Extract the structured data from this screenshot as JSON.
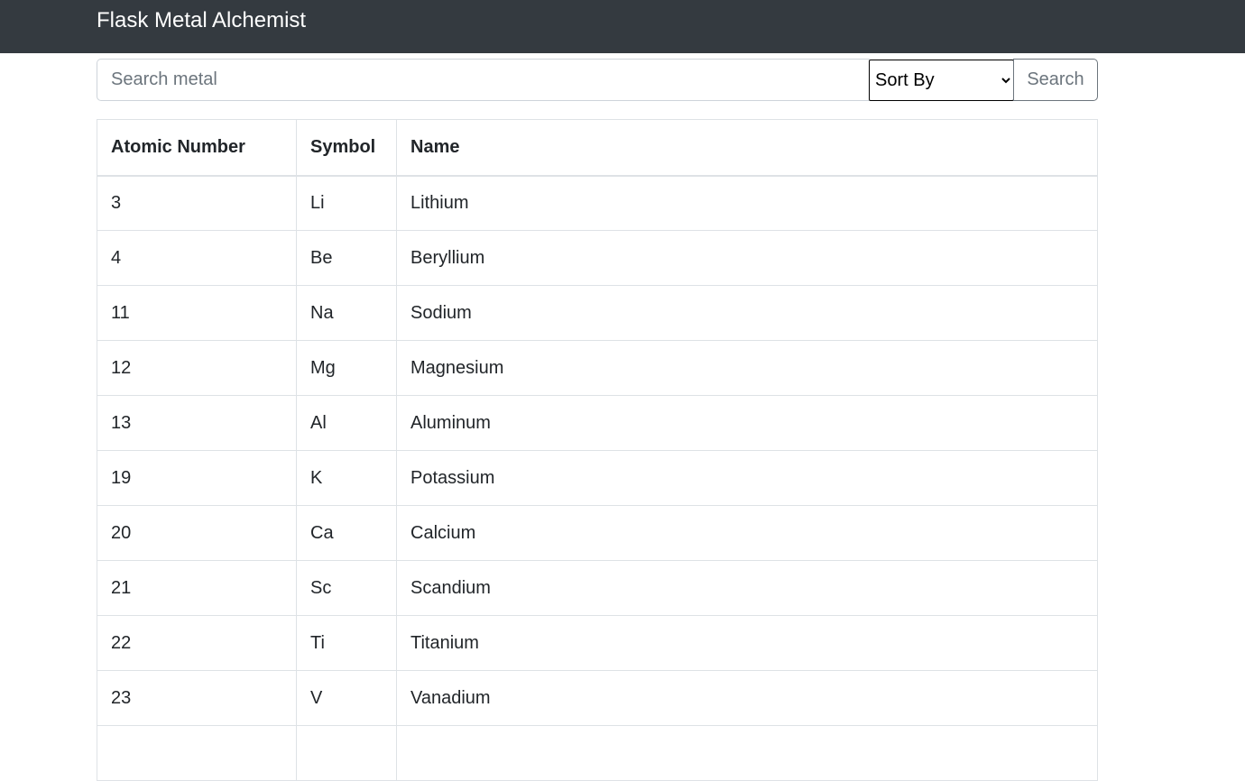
{
  "navbar": {
    "brand": "Flask Metal Alchemist"
  },
  "search": {
    "placeholder": "Search metal",
    "value": "",
    "sort_selected": "Sort By",
    "button_label": "Search"
  },
  "table": {
    "headers": [
      "Atomic Number",
      "Symbol",
      "Name"
    ],
    "rows": [
      [
        "3",
        "Li",
        "Lithium"
      ],
      [
        "4",
        "Be",
        "Beryllium"
      ],
      [
        "11",
        "Na",
        "Sodium"
      ],
      [
        "12",
        "Mg",
        "Magnesium"
      ],
      [
        "13",
        "Al",
        "Aluminum"
      ],
      [
        "19",
        "K",
        "Potassium"
      ],
      [
        "20",
        "Ca",
        "Calcium"
      ],
      [
        "21",
        "Sc",
        "Scandium"
      ],
      [
        "22",
        "Ti",
        "Titanium"
      ],
      [
        "23",
        "V",
        "Vanadium"
      ],
      [
        "",
        "",
        ""
      ]
    ]
  },
  "colors": {
    "navbar_bg": "#343a40",
    "border": "#dee2e6"
  }
}
